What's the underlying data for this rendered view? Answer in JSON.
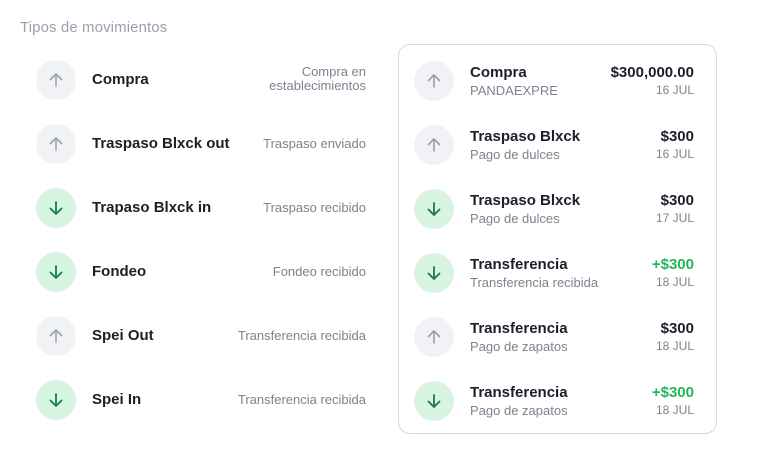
{
  "section": {
    "title": "Tipos de movimientos"
  },
  "colors": {
    "out_bg": "#f1f2f5",
    "out_arrow": "#9aa0ad",
    "in_bg": "#d7f5e1",
    "in_arrow": "#1f7a45",
    "positive_amount": "#22b55a"
  },
  "types": [
    {
      "direction": "out",
      "icon": "arrow-up-icon",
      "name": "Compra",
      "description": "Compra en establecimientos"
    },
    {
      "direction": "out",
      "icon": "arrow-up-icon",
      "name": "Traspaso Blxck out",
      "description": "Traspaso enviado"
    },
    {
      "direction": "in",
      "icon": "arrow-down-icon",
      "name": "Trapaso Blxck in",
      "description": "Traspaso recibido"
    },
    {
      "direction": "in",
      "icon": "arrow-down-icon",
      "name": "Fondeo",
      "description": "Fondeo recibido"
    },
    {
      "direction": "out",
      "icon": "arrow-up-icon",
      "name": "Spei Out",
      "description": "Transferencia recibida"
    },
    {
      "direction": "in",
      "icon": "arrow-down-icon",
      "name": "Spei In",
      "description": "Transferencia recibida"
    }
  ],
  "transactions": [
    {
      "direction": "out",
      "icon": "arrow-up-icon",
      "title": "Compra",
      "subtitle": "PANDAEXPRE",
      "amount": "$300,000.00",
      "date": "16 JUL"
    },
    {
      "direction": "out",
      "icon": "arrow-up-icon",
      "title": "Traspaso Blxck",
      "subtitle": "Pago de dulces",
      "amount": "$300",
      "date": "16 JUL"
    },
    {
      "direction": "in",
      "icon": "arrow-down-icon",
      "title": "Traspaso Blxck",
      "subtitle": "Pago de dulces",
      "amount": "$300",
      "date": "17 JUL"
    },
    {
      "direction": "in",
      "icon": "arrow-down-icon",
      "title": "Transferencia",
      "subtitle": "Transferencia recibida",
      "amount": "+$300",
      "date": "18 JUL"
    },
    {
      "direction": "out",
      "icon": "arrow-up-icon",
      "title": "Transferencia",
      "subtitle": "Pago de zapatos",
      "amount": "$300",
      "date": "18 JUL"
    },
    {
      "direction": "in",
      "icon": "arrow-down-icon",
      "title": "Transferencia",
      "subtitle": "Pago de zapatos",
      "amount": "+$300",
      "date": "18 JUL"
    }
  ]
}
